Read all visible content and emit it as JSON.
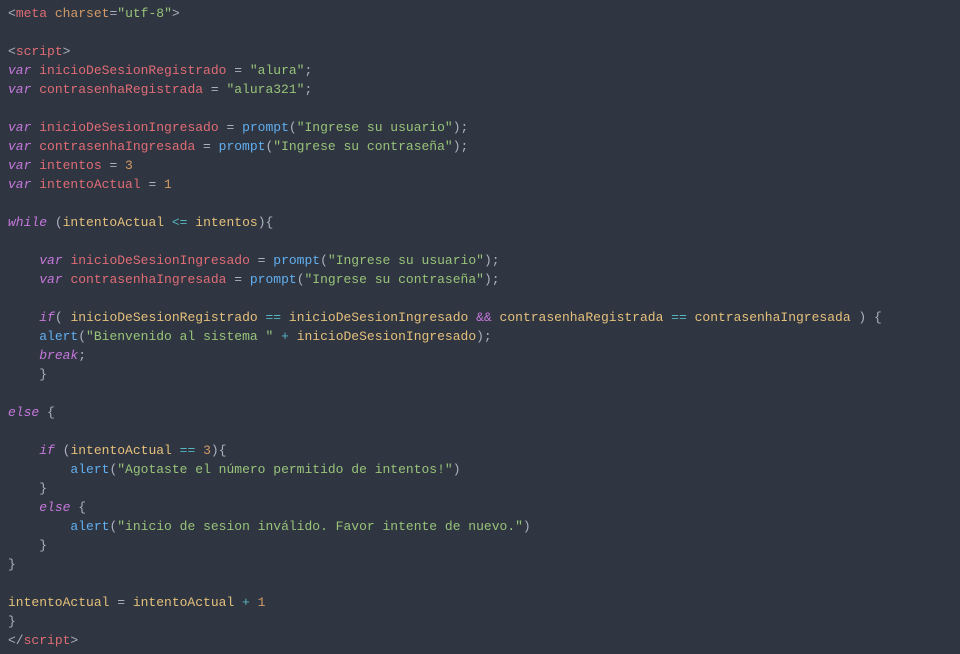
{
  "lines": {
    "l1": {
      "t1": "<",
      "t2": "meta",
      "t3": " ",
      "t4": "charset",
      "t5": "=",
      "t6": "\"utf-8\"",
      "t7": ">"
    },
    "l2": "",
    "l3": {
      "t1": "<",
      "t2": "script",
      "t3": ">"
    },
    "l4": {
      "kw": "var",
      "sp": " ",
      "id": "inicioDeSesionRegistrado",
      "eq": " = ",
      "str": "\"alura\"",
      "end": ";"
    },
    "l5": {
      "kw": "var",
      "sp": " ",
      "id": "contrasenhaRegistrada",
      "eq": " = ",
      "str": "\"alura321\"",
      "end": ";"
    },
    "l6": "",
    "l7": {
      "kw": "var",
      "sp": " ",
      "id": "inicioDeSesionIngresado",
      "eq": " = ",
      "fn": "prompt",
      "p1": "(",
      "str": "\"Ingrese su usuario\"",
      "p2": ");"
    },
    "l8": {
      "kw": "var",
      "sp": " ",
      "id": "contrasenhaIngresada",
      "eq": " = ",
      "fn": "prompt",
      "p1": "(",
      "str": "\"Ingrese su contraseña\"",
      "p2": ");"
    },
    "l9": {
      "kw": "var",
      "sp": " ",
      "id": "intentos",
      "eq": " = ",
      "num": "3"
    },
    "l10": {
      "kw": "var",
      "sp": " ",
      "id": "intentoActual",
      "eq": " = ",
      "num": "1"
    },
    "l11": "",
    "l12": {
      "kw": "while",
      "sp": " (",
      "id": "intentoActual",
      "op": " <= ",
      "id2": "intentos",
      "end": "){"
    },
    "l13": "",
    "l14": {
      "pad": "    ",
      "kw": "var",
      "sp": " ",
      "id": "inicioDeSesionIngresado",
      "eq": " = ",
      "fn": "prompt",
      "p1": "(",
      "str": "\"Ingrese su usuario\"",
      "p2": ");"
    },
    "l15": {
      "pad": "    ",
      "kw": "var",
      "sp": " ",
      "id": "contrasenhaIngresada",
      "eq": " = ",
      "fn": "prompt",
      "p1": "(",
      "str": "\"Ingrese su contraseña\"",
      "p2": ");"
    },
    "l16": "",
    "l17": {
      "pad": "    ",
      "kw": "if",
      "p1": "( ",
      "id1": "inicioDeSesionRegistrado",
      "op1": " == ",
      "id2": "inicioDeSesionIngresado",
      "amp": " && ",
      "id3": "contrasenhaRegistrada",
      "op2": " == ",
      "id4": "contrasenhaIngresada",
      "p2": " ) {"
    },
    "l18": {
      "pad": "    ",
      "fn": "alert",
      "p1": "(",
      "str": "\"Bienvenido al sistema \"",
      "op": " + ",
      "id": "inicioDeSesionIngresado",
      "p2": ");"
    },
    "l19": {
      "pad": "    ",
      "kw": "break",
      "end": ";"
    },
    "l20": {
      "pad": "    ",
      "brace": "}"
    },
    "l21": "",
    "l22": {
      "kw": "else",
      "sp": " {"
    },
    "l23": "",
    "l24": {
      "pad": "    ",
      "kw": "if",
      "p1": " (",
      "id": "intentoActual",
      "op": " == ",
      "num": "3",
      "p2": "){"
    },
    "l25": {
      "pad": "        ",
      "fn": "alert",
      "p1": "(",
      "str": "\"Agotaste el número permitido de intentos!\"",
      "p2": ")"
    },
    "l26": {
      "pad": "    ",
      "brace": "}"
    },
    "l27": {
      "pad": "    ",
      "kw": "else",
      "sp": " {"
    },
    "l28": {
      "pad": "        ",
      "fn": "alert",
      "p1": "(",
      "str": "\"inicio de sesion inválido. Favor intente de nuevo.\"",
      "p2": ")"
    },
    "l29": {
      "pad": "    ",
      "brace": "}"
    },
    "l30": {
      "brace": "}"
    },
    "l31": "",
    "l32": {
      "id": "intentoActual",
      "eq": " = ",
      "id2": "intentoActual",
      "op": " + ",
      "num": "1"
    },
    "l33": {
      "brace": "}"
    },
    "l34": {
      "t1": "</",
      "t2": "script",
      "t3": ">"
    }
  }
}
